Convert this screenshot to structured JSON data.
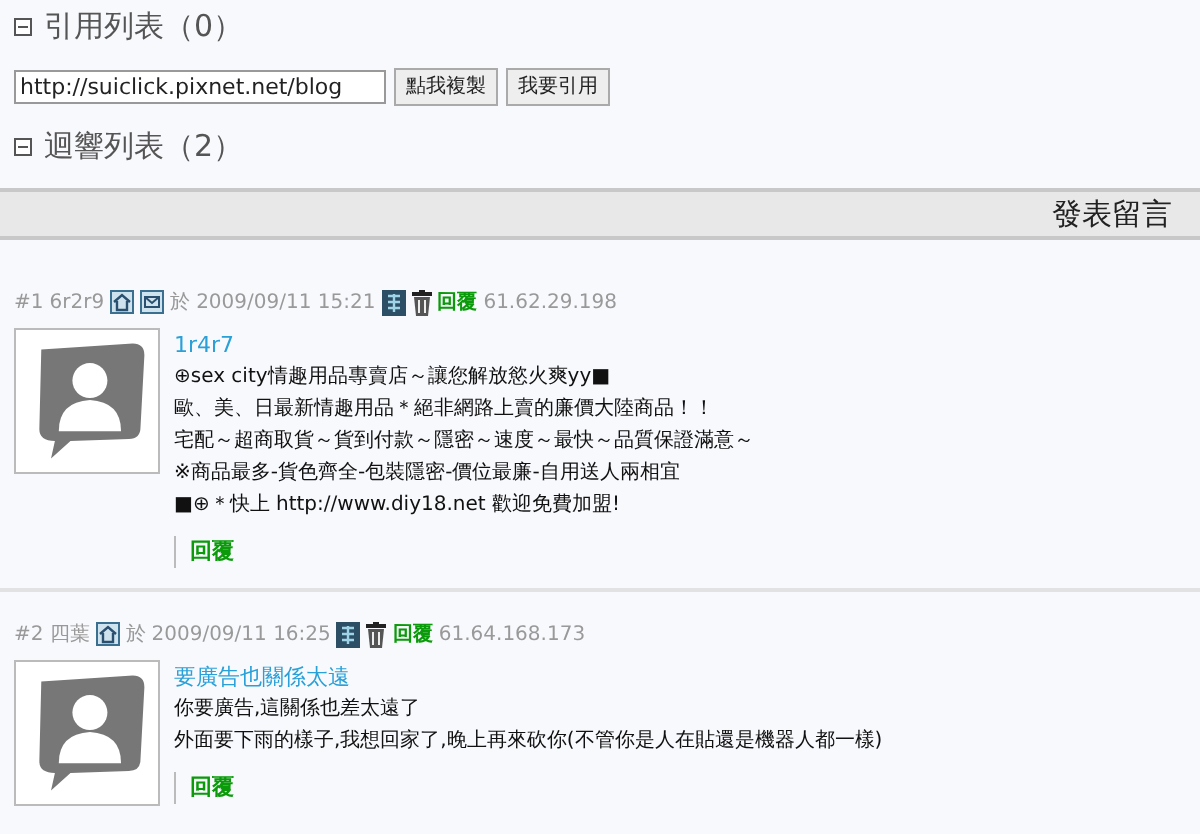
{
  "trackback": {
    "title": "引用列表（0）",
    "url": "http://suiclick.pixnet.net/blog",
    "buttons": [
      "點我複製",
      "我要引用"
    ]
  },
  "responses_title": "迴響列表（2）",
  "post_bar": {
    "label": "發表留言"
  },
  "comments": [
    {
      "number": "#1",
      "author": "6r2r9",
      "has_mail": true,
      "at": "於",
      "time": "2009/09/11 15:21",
      "reply_tag": "回覆",
      "ip": "61.62.29.198",
      "title": "1r4r7",
      "lines": [
        "⊕sex city情趣用品專賣店～讓您解放慾火爽yy■",
        "歐、美、日最新情趣用品＊絕非網路上賣的廉價大陸商品！！",
        "宅配～超商取貨～貨到付款～隱密～速度～最快～品質保證滿意～",
        "※商品最多-貨色齊全-包裝隱密-價位最廉-自用送人兩相宜",
        "■⊕＊快上 http://www.diy18.net 歡迎免費加盟!"
      ],
      "reply": "回覆"
    },
    {
      "number": "#2",
      "author": "四葉",
      "has_mail": false,
      "at": "於",
      "time": "2009/09/11 16:25",
      "reply_tag": "回覆",
      "ip": "61.64.168.173",
      "title": "要廣告也關係太遠",
      "lines": [
        "你要廣告,這關係也差太遠了",
        "外面要下雨的樣子,我想回家了,晚上再來砍你(不管你是人在貼還是機器人都一樣)"
      ],
      "reply": "回覆"
    }
  ]
}
